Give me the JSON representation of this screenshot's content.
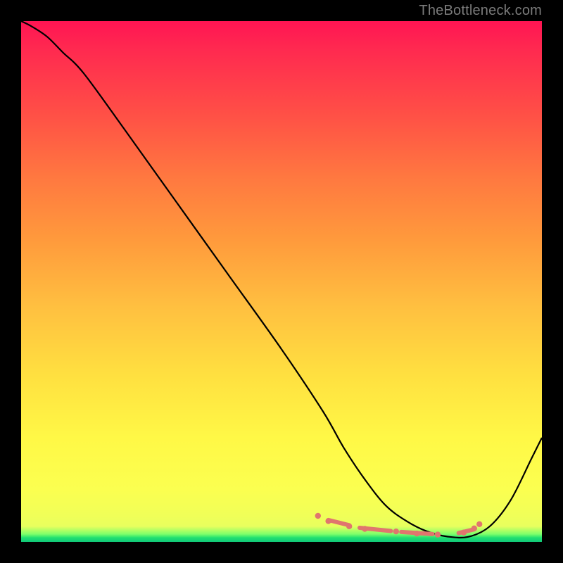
{
  "watermark": "TheBottleneck.com",
  "chart_data": {
    "type": "line",
    "title": "",
    "xlabel": "",
    "ylabel": "",
    "xlim": [
      0,
      100
    ],
    "ylim": [
      0,
      100
    ],
    "series": [
      {
        "name": "curve",
        "x": [
          0,
          2,
          5,
          8,
          12,
          20,
          30,
          40,
          50,
          58,
          62,
          66,
          70,
          74,
          78,
          82,
          86,
          90,
          94,
          98,
          100
        ],
        "y": [
          100,
          99,
          97,
          94,
          90,
          79,
          65,
          51,
          37,
          25,
          18,
          12,
          7,
          4,
          2,
          1,
          1,
          3,
          8,
          16,
          20
        ]
      }
    ],
    "markers": {
      "dots_x": [
        57,
        59,
        63,
        66,
        72,
        76,
        80,
        85,
        87,
        88
      ],
      "dots_y": [
        5,
        4,
        3,
        2.5,
        2,
        1.6,
        1.4,
        1.8,
        2.6,
        3.4
      ],
      "dashes": [
        {
          "x1": 59,
          "y1": 4.2,
          "x2": 63,
          "y2": 3.2
        },
        {
          "x1": 65,
          "y1": 2.7,
          "x2": 71,
          "y2": 2.1
        },
        {
          "x1": 73,
          "y1": 1.9,
          "x2": 79,
          "y2": 1.5
        },
        {
          "x1": 84,
          "y1": 1.7,
          "x2": 87,
          "y2": 2.4
        }
      ]
    }
  }
}
